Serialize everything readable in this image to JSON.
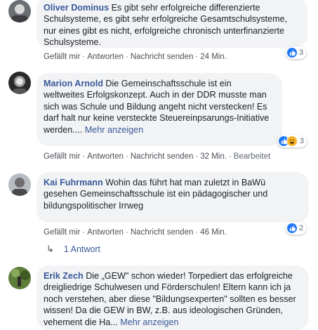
{
  "comments": [
    {
      "author": "Oliver Dominus",
      "text": "Es gibt sehr erfolgreiche differenzierte Schulsysteme, es gibt sehr erfolgreiche Gesamtschulsysteme, nur eines gibt es nicht, erfolgreiche chronisch unterfinanzierte Schulsysteme.",
      "like": "Gefällt mir",
      "reply": "Antworten",
      "message": "Nachricht senden",
      "time": "24 Min.",
      "reaction_count": "3",
      "reaction_icons": [
        "like-icon"
      ]
    },
    {
      "author": "Marion Arnold",
      "text": "Die Gemeinschaftsschule ist ein weltweites Erfolgskonzept. Auch in der DDR musste man sich was Schule und Bildung angeht nicht verstecken! Es darf halt nur keine versteckte Steuereinpsarungs-Initiative werden....",
      "more": "Mehr anzeigen",
      "like": "Gefällt mir",
      "reply": "Antworten",
      "message": "Nachricht senden",
      "time": "32 Min.",
      "edited": "Bearbeitet",
      "reaction_count": "3",
      "reaction_icons": [
        "like-icon",
        "haha-icon"
      ]
    },
    {
      "author": "Kai Fuhrmann",
      "text": "Wohin das führt hat man zuletzt in BaWü gesehen Gemeinschaftsschule ist ein pädagogischer und bildungspolitischer Irrweg",
      "like": "Gefällt mir",
      "reply": "Antworten",
      "message": "Nachricht senden",
      "time": "46 Min.",
      "reaction_count": "2",
      "reaction_icons": [
        "like-icon"
      ],
      "replies_label": "1 Antwort"
    },
    {
      "author": "Erik Zech",
      "text": "Die „GEW\" schon wieder! Torpediert das erfolgreiche dreigliedrige Schulwesen und Förderschulen! Eltern kann ich ja noch verstehen, aber diese \"Bildungsexperten\" sollten es besser wissen! Da die GEW in BW, z.B. aus ideologischen Gründen, vehement die Ha...",
      "more": "Mehr anzeigen"
    }
  ],
  "colors": {
    "link": "#385898",
    "bubble": "#f2f3f5",
    "like": "#2078f4",
    "haha": "#f7b125"
  }
}
